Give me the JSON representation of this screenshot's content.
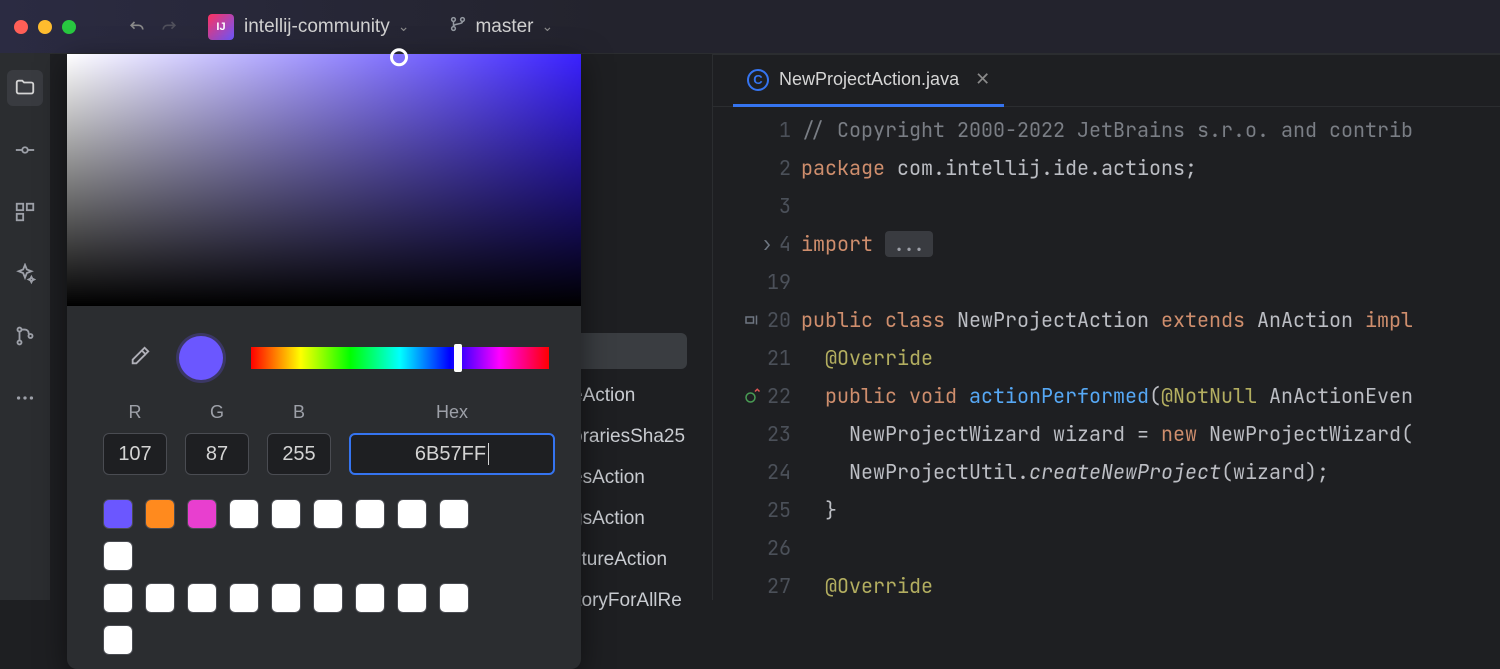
{
  "titlebar": {
    "project": "intellij-community",
    "branch": "master"
  },
  "toolrail": {
    "items": [
      "project",
      "commit",
      "structure",
      "ai",
      "vcs",
      "more"
    ]
  },
  "picker": {
    "labels": {
      "r": "R",
      "g": "G",
      "b": "B",
      "hex": "Hex"
    },
    "values": {
      "r": "107",
      "g": "87",
      "b": "255",
      "hex": "6B57FF"
    },
    "current_color": "#6b57ff",
    "swatches_row1": [
      "#6b57ff",
      "#ff8a1e",
      "#e83fcf",
      "#ffffff",
      "#ffffff",
      "#ffffff",
      "#ffffff",
      "#ffffff",
      "#ffffff",
      "#ffffff"
    ],
    "swatches_row2": [
      "#ffffff",
      "#ffffff",
      "#ffffff",
      "#ffffff",
      "#ffffff",
      "#ffffff",
      "#ffffff",
      "#ffffff",
      "#ffffff",
      "#ffffff"
    ]
  },
  "behind_list": {
    "selected": "",
    "items": [
      "eAction",
      "orariesSha25",
      "esAction",
      "gsAction",
      "ctureAction",
      "itoryForAllRe"
    ]
  },
  "editor": {
    "tab": {
      "filename": "NewProjectAction.java"
    },
    "line_numbers": [
      "1",
      "2",
      "3",
      "4",
      "19",
      "20",
      "21",
      "22",
      "23",
      "24",
      "25",
      "26",
      "27"
    ],
    "code": {
      "l1_comment": "// Copyright 2000-2022 JetBrains s.r.o. and contrib",
      "l2_kw": "package",
      "l2_pkg": " com.intellij.ide.actions;",
      "l4_kw": "import",
      "l4_fold": "...",
      "l20_kw1": "public class",
      "l20_name": " NewProjectAction ",
      "l20_kw2": "extends",
      "l20_ext": " AnAction ",
      "l20_kw3": "impl",
      "l21_ann": "@Override",
      "l22_kw": "public void",
      "l22_fn": " actionPerformed",
      "l22_rest1": "(",
      "l22_ann": "@NotNull",
      "l22_rest2": " AnActionEven",
      "l23": "NewProjectWizard wizard = ",
      "l23_kw": "new",
      "l23_tail": " NewProjectWizard(",
      "l24_a": "NewProjectUtil.",
      "l24_fn": "createNewProject",
      "l24_b": "(wizard);",
      "l25": "}",
      "l27_ann": "@Override"
    }
  }
}
